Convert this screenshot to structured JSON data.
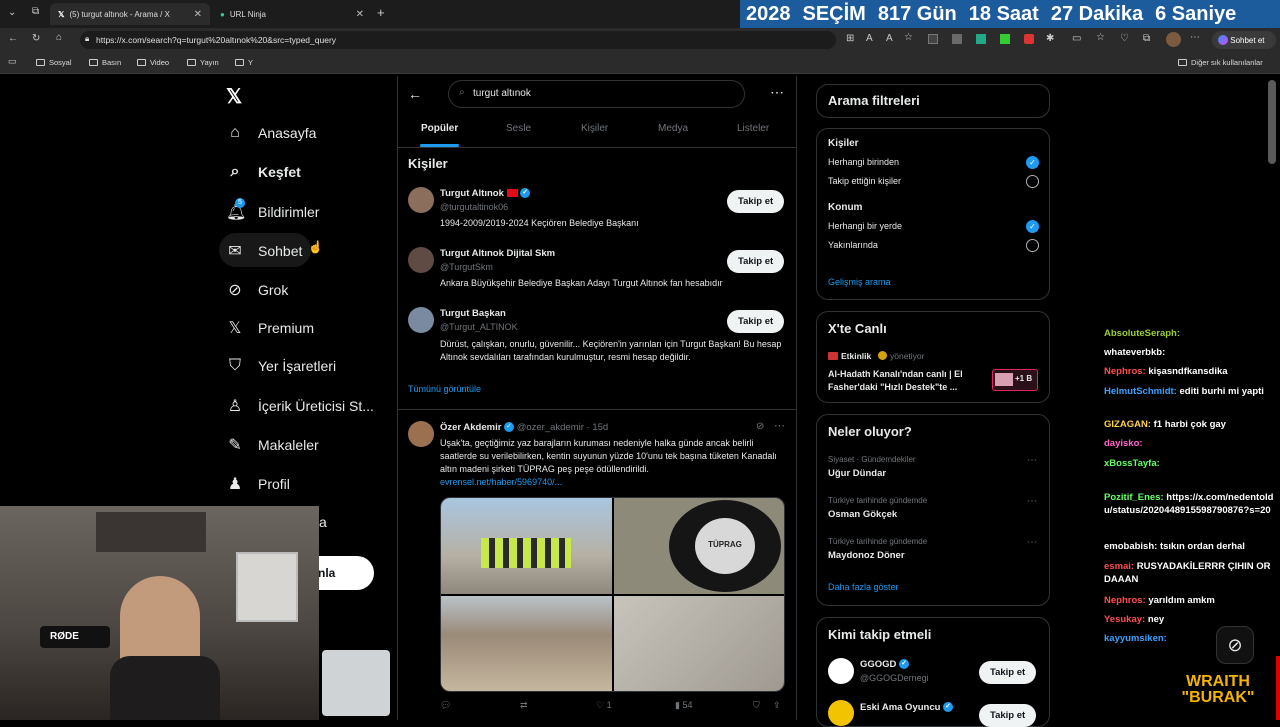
{
  "browser": {
    "tabs": [
      {
        "title": "(5) turgut altınok - Arama / X",
        "active": true
      },
      {
        "title": "URL Ninja",
        "active": false
      }
    ],
    "url": "https://x.com/search?q=turgut%20altınok%20&src=typed_query",
    "copilot_label": "Sohbet et",
    "bookmarks": [
      "Sosyal",
      "Basın",
      "Video",
      "Yayın",
      "Y"
    ],
    "other_favorites": "Diğer sık kullanılanlar"
  },
  "countdown": {
    "year_label": "2028",
    "event": "SEÇİM",
    "days": "817 Gün",
    "hours": "18 Saat",
    "minutes": "27 Dakika",
    "seconds": "6 Saniye"
  },
  "sidebar": {
    "items": [
      {
        "label": "Anasayfa",
        "icon": "home-icon"
      },
      {
        "label": "Keşfet",
        "icon": "search-icon"
      },
      {
        "label": "Bildirimler",
        "icon": "bell-icon"
      },
      {
        "label": "Sohbet",
        "icon": "mail-icon"
      },
      {
        "label": "Grok",
        "icon": "grok-icon"
      },
      {
        "label": "Premium",
        "icon": "x-icon"
      },
      {
        "label": "Yer İşaretleri",
        "icon": "bookmark-icon"
      },
      {
        "label": "İçerik Üreticisi St...",
        "icon": "creator-icon"
      },
      {
        "label": "Makaleler",
        "icon": "article-icon"
      },
      {
        "label": "Profil",
        "icon": "person-icon"
      }
    ],
    "notification_badge": "5",
    "post_button_fragment": "nla",
    "partial_item_fragment": "a"
  },
  "search": {
    "query": "turgut altınok",
    "tabs": [
      "Popüler",
      "Sesle",
      "Kişiler",
      "Medya",
      "Listeler"
    ],
    "active_tab": "Popüler"
  },
  "people": {
    "heading": "Kişiler",
    "follow_label": "Takip et",
    "show_all": "Tümünü görüntüle",
    "list": [
      {
        "name": "Turgut Altınok",
        "handle": "@turgutaltinok06",
        "bio": "1994-2009/2019-2024 Keçiören Belediye Başkanı"
      },
      {
        "name": "Turgut Altınok Dijital Skm",
        "handle": "@TurgutSkm",
        "bio": "Ankara Büyükşehir Belediye Başkan Adayı Turgut Altınok fan hesabıdır"
      },
      {
        "name": "Turgut Başkan",
        "handle": "@Turgut_ALTINOK",
        "bio": "Dürüst, çalışkan, onurlu, güvenilir... Keçiören'in yarınları için Turgut Başkan! Bu hesap Altınok sevdalıları tarafından kurulmuştur, resmi hesap değildir."
      }
    ]
  },
  "post": {
    "author": "Özer Akdemir",
    "handle": "@ozer_akdemir",
    "time": "· 15d",
    "text": "Uşak'ta, geçtiğimiz yaz barajların kuruması nedeniyle halka günde ancak belirli saatlerde su verilebilirken, kentin suyunun yüzde 10'unu tek başına tüketen Kanadalı altın madeni şirketi TÜPRAG peş peşe ödüllendirildi.",
    "link": "evrensel.net/haber/5969740/...",
    "image_logo_text": "TÜPRAG",
    "likes": "1",
    "views": "54"
  },
  "filters": {
    "title": "Arama filtreleri",
    "people_heading": "Kişiler",
    "people_options": [
      "Herhangi birinden",
      "Takip ettiğin kişiler"
    ],
    "location_heading": "Konum",
    "location_options": [
      "Herhangi bir yerde",
      "Yakınlarında"
    ],
    "advanced": "Gelişmiş arama"
  },
  "live": {
    "title": "X'te Canlı",
    "source": "Etkinlik",
    "role": "yönetiyor",
    "headline": "Al-Hadath Kanalı'ndan canlı | El Fasher'daki \"Hızlı Destek\"te ...",
    "badge": "+1 B"
  },
  "trends": {
    "title": "Neler oluyor?",
    "items": [
      {
        "context": "Siyaset · Gündemdekiler",
        "name": "Uğur Dündar"
      },
      {
        "context": "Türkiye tarihinde gündemde",
        "name": "Osman Gökçek"
      },
      {
        "context": "Türkiye tarihinde gündemde",
        "name": "Maydonoz Döner"
      }
    ],
    "more": "Daha fazla göster"
  },
  "who_to_follow": {
    "title": "Kimi takip etmeli",
    "follow_label": "Takip et",
    "items": [
      {
        "name": "GGOGD",
        "handle": "@GGOGDernegi"
      },
      {
        "name": "Eski Ama Oyuncu",
        "handle": ""
      }
    ]
  },
  "chat": [
    {
      "user": "AbsoluteSeraph:",
      "msg": "",
      "color": "#9acd32"
    },
    {
      "user": "whateverbkb:",
      "msg": "",
      "color": "#ffffff"
    },
    {
      "user": "Nephros:",
      "msg": "kişasndfkansdika",
      "color": "#ff4d4d"
    },
    {
      "user": "HelmutSchmidt:",
      "msg": "editi burhi mi yapti",
      "color": "#3aa0ff"
    },
    {
      "user": "GIZAGAN:",
      "msg": "f1 harbi çok gay",
      "color": "#ffd24d"
    },
    {
      "user": "dayisko:",
      "msg": "",
      "color": "#ff66cc"
    },
    {
      "user": "xBossTayfa:",
      "msg": "",
      "color": "#66ff66"
    },
    {
      "user": "Pozitif_Enes:",
      "msg": "https://x.com/nedentoldu/status/2020448915598790876?s=20",
      "color": "#66ff66"
    },
    {
      "user": "emobabish:",
      "msg": "tsıkın ordan derhal",
      "color": "#ffffff"
    },
    {
      "user": "esmai:",
      "msg": "RUSYADAKİLERRR ÇIHIN ORDAAAN",
      "color": "#ff4d4d"
    },
    {
      "user": "Nephros:",
      "msg": "yarıldım amkm",
      "color": "#ff4d4d"
    },
    {
      "user": "Yesukay:",
      "msg": "ney",
      "color": "#ff4d4d"
    },
    {
      "user": "kayyumsiken:",
      "msg": "",
      "color": "#3aa0ff"
    }
  ],
  "streamer": {
    "logo_text_1": "WRAITH",
    "logo_text_2": "\"BURAK\"",
    "mic_brand": "RØDE"
  }
}
